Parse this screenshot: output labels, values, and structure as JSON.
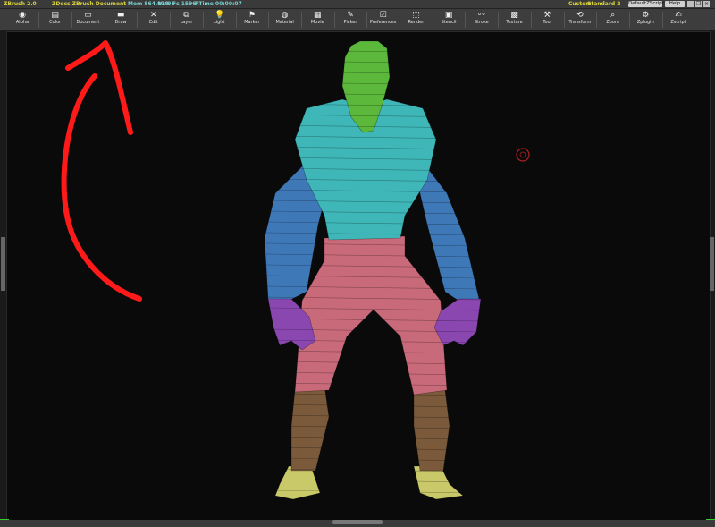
{
  "titlebar": {
    "app": "ZBrush 2.0",
    "document": "ZDocs ZBrush Document",
    "mem": "Mem 864.938",
    "vs": "Vs 95",
    "fs": "Fs 1596",
    "timer": "RTime 00:00:07",
    "layout": "Custom",
    "color_label": "Standard 2",
    "default_script": "DefaultZScript",
    "help": "Help"
  },
  "menu": [
    {
      "label": "Alpha",
      "icon": "alpha-icon"
    },
    {
      "label": "Color",
      "icon": "color-icon"
    },
    {
      "label": "Document",
      "icon": "document-icon"
    },
    {
      "label": "Draw",
      "icon": "draw-icon"
    },
    {
      "label": "Edit",
      "icon": "edit-icon"
    },
    {
      "label": "Layer",
      "icon": "layer-icon"
    },
    {
      "label": "Light",
      "icon": "light-icon"
    },
    {
      "label": "Marker",
      "icon": "marker-icon"
    },
    {
      "label": "Material",
      "icon": "material-icon"
    },
    {
      "label": "Movie",
      "icon": "movie-icon"
    },
    {
      "label": "Picker",
      "icon": "picker-icon"
    },
    {
      "label": "Preferences",
      "icon": "preferences-icon"
    },
    {
      "label": "Render",
      "icon": "render-icon"
    },
    {
      "label": "Stencil",
      "icon": "stencil-icon"
    },
    {
      "label": "Stroke",
      "icon": "stroke-icon"
    },
    {
      "label": "Texture",
      "icon": "texture-icon"
    },
    {
      "label": "Tool",
      "icon": "tool-icon"
    },
    {
      "label": "Transform",
      "icon": "transform-icon"
    },
    {
      "label": "Zoom",
      "icon": "zoom-icon"
    },
    {
      "label": "Zplugin",
      "icon": "zplugin-icon"
    },
    {
      "label": "Zscript",
      "icon": "zscript-icon"
    }
  ],
  "colors": {
    "head": "#5cb83a",
    "torso": "#3fb7b9",
    "arms": "#3f78b7",
    "hands": "#8a47b0",
    "legs": "#c96a7a",
    "shins": "#7a5a3a",
    "feet": "#c9c96a",
    "annotation": "#ff1a1a"
  }
}
